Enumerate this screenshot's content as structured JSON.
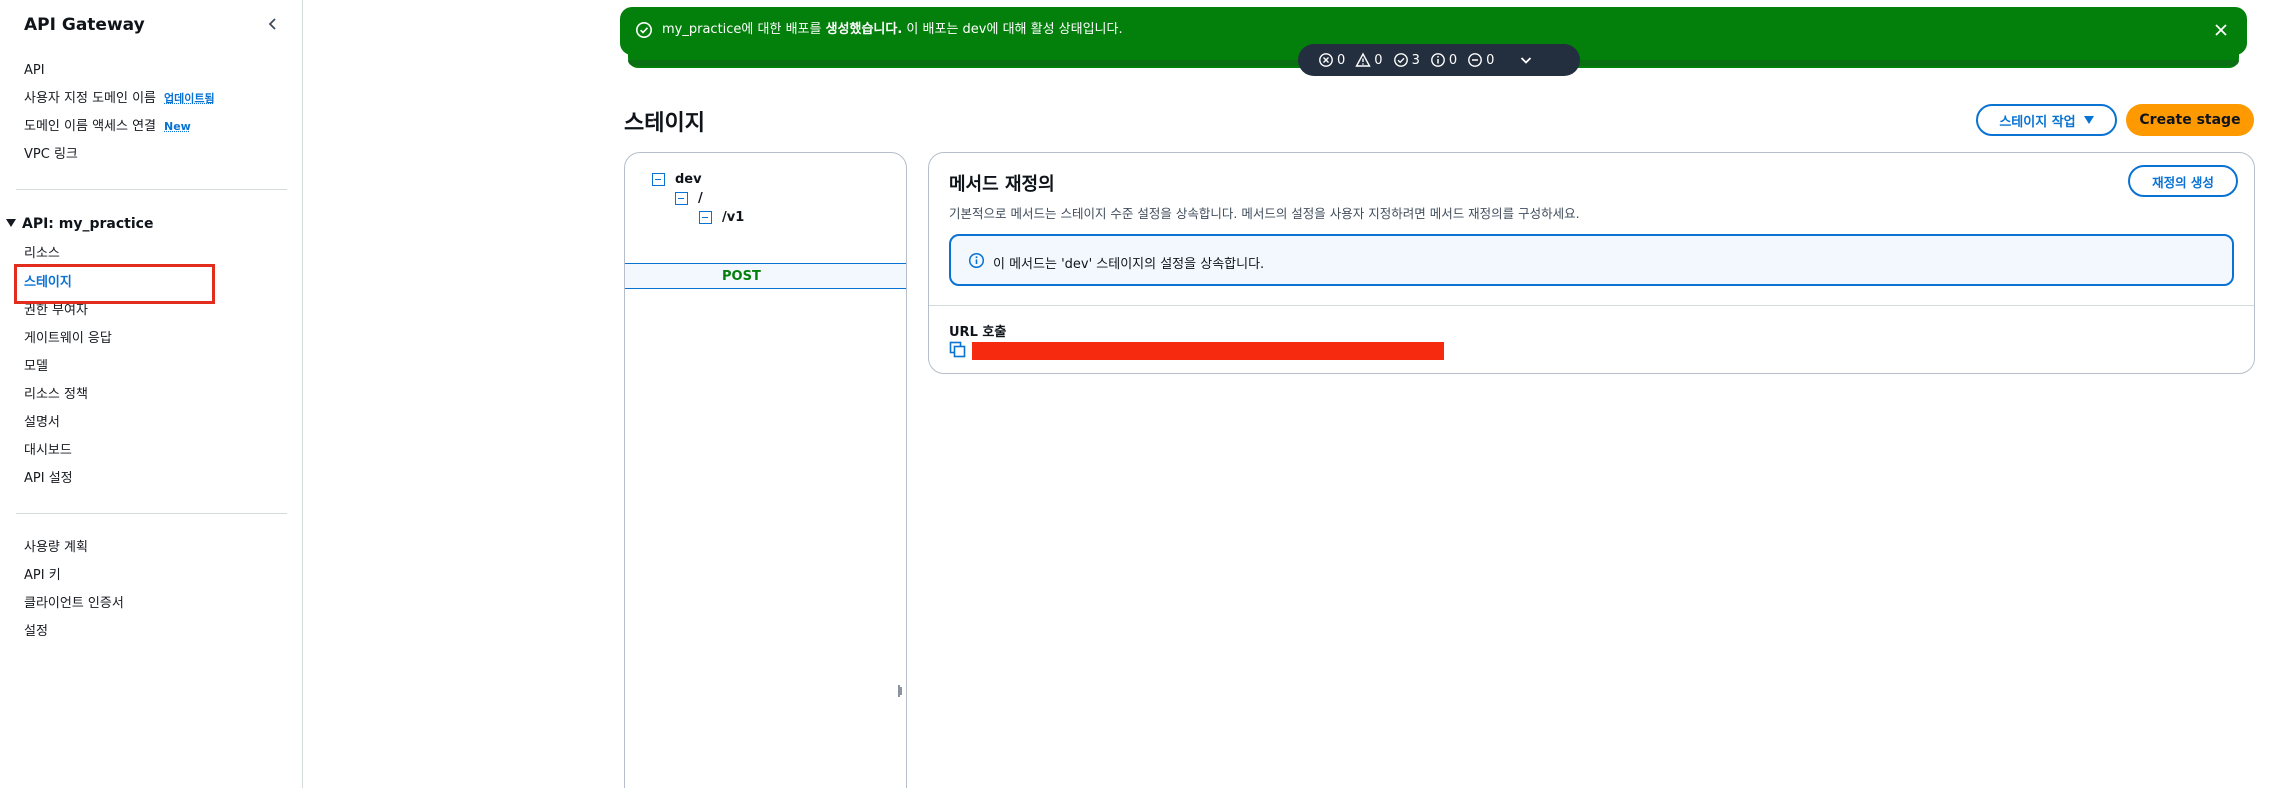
{
  "sidebar": {
    "title": "API Gateway",
    "top_items": [
      {
        "label": "API"
      },
      {
        "label": "사용자 지정 도메인 이름",
        "badge": "업데이트됨"
      },
      {
        "label": "도메인 이름 액세스 연결",
        "badge": "New"
      },
      {
        "label": "VPC 링크"
      }
    ],
    "api_section": "API: my_practice",
    "api_items": [
      {
        "label": "리소스"
      },
      {
        "label": "스테이지"
      },
      {
        "label": "권한 부여자"
      },
      {
        "label": "게이트웨이 응답"
      },
      {
        "label": "모델"
      },
      {
        "label": "리소스 정책"
      },
      {
        "label": "설명서"
      },
      {
        "label": "대시보드"
      },
      {
        "label": "API 설정"
      }
    ],
    "bottom_items": [
      {
        "label": "사용량 계획"
      },
      {
        "label": "API 키"
      },
      {
        "label": "클라이언트 인증서"
      },
      {
        "label": "설정"
      }
    ]
  },
  "flash": {
    "message_part1": "my_practice에 대한 배포를 ",
    "message_bold": "생성했습니다.",
    "message_part2": " 이 배포는 dev에 대해 활성 상태입니다.",
    "counts": {
      "error": "0",
      "warning": "0",
      "success": "3",
      "info": "0",
      "in_progress": "0"
    },
    "color": "#037f0c"
  },
  "page": {
    "title": "스테이지",
    "actions_label": "스테이지 작업",
    "create_label": "Create stage"
  },
  "tree": {
    "stage": "dev",
    "root": "/",
    "resource": "/v1",
    "method": "POST"
  },
  "detail": {
    "title": "메서드 재정의",
    "description": "기본적으로 메서드는 스테이지 수준 설정을 상속합니다. 메서드의 설정을 사용자 지정하려면 메서드 재정의를 구성하세요.",
    "override_button": "재정의 생성",
    "info_text": "이 메서드는 'dev' 스테이지의 설정을 상속합니다.",
    "url_label": "URL 호출"
  }
}
